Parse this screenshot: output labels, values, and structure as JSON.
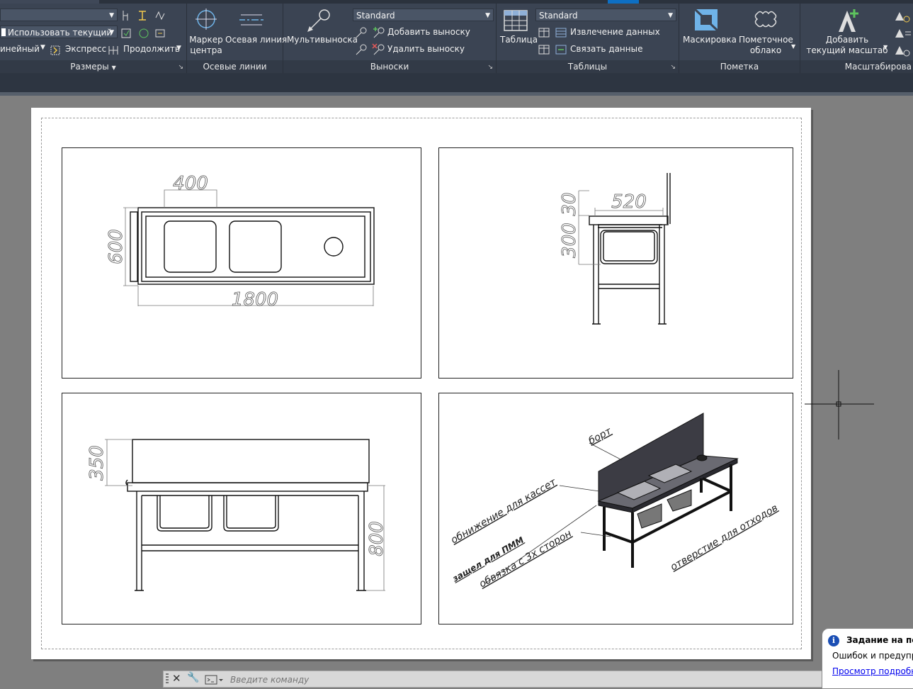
{
  "ribbon": {
    "dimensions_panel": {
      "title": "Размеры",
      "style_value": "",
      "layer_value": "Использовать текущий",
      "linear_label": "инейный",
      "express_label": "Экспресс",
      "continue_label": "Продолжить"
    },
    "centerlines_panel": {
      "title": "Осевые линии",
      "center_mark_label": "Маркер центра",
      "center_mark_line1": "Маркер",
      "center_mark_line2": "центра",
      "centerline_label": "Осевая линия"
    },
    "leaders_panel": {
      "title": "Выноски",
      "multileader_label": "Мультивыноска",
      "style_value": "Standard",
      "add_leader_label": "Добавить выноску",
      "remove_leader_label": "Удалить выноску"
    },
    "tables_panel": {
      "title": "Таблицы",
      "table_label": "Таблица",
      "style_value": "Standard",
      "extract_label": "Извлечение данных",
      "link_label": "Связать данные"
    },
    "markup_panel": {
      "title": "Пометка",
      "wipeout_label": "Маскировка",
      "cloud_line1": "Пометочное",
      "cloud_line2": "облако"
    },
    "scale_panel": {
      "title": "Масштабирова",
      "add_scale_line1": "Добавить",
      "add_scale_line2": "текущий масштаб"
    }
  },
  "drawing": {
    "top_view": {
      "dim_width": "400",
      "dim_depth": "600",
      "dim_length": "1800"
    },
    "side_view": {
      "dim_width": "520",
      "dim_top": "30",
      "dim_height": "300"
    },
    "front_view": {
      "dim_splash": "350",
      "dim_height": "800"
    },
    "iso_view": {
      "label_board": "борт",
      "label_cassette": "обнижение для кассет",
      "label_mixer": "защел для ПММ",
      "label_frame": "обвязка с 3х сторон",
      "label_hole": "отверстие для отходов"
    }
  },
  "command_line": {
    "placeholder": "Введите команду"
  },
  "notification": {
    "title": "Задание на печа",
    "message": "Ошибок и предупре",
    "link": "Просмотр подробно"
  }
}
